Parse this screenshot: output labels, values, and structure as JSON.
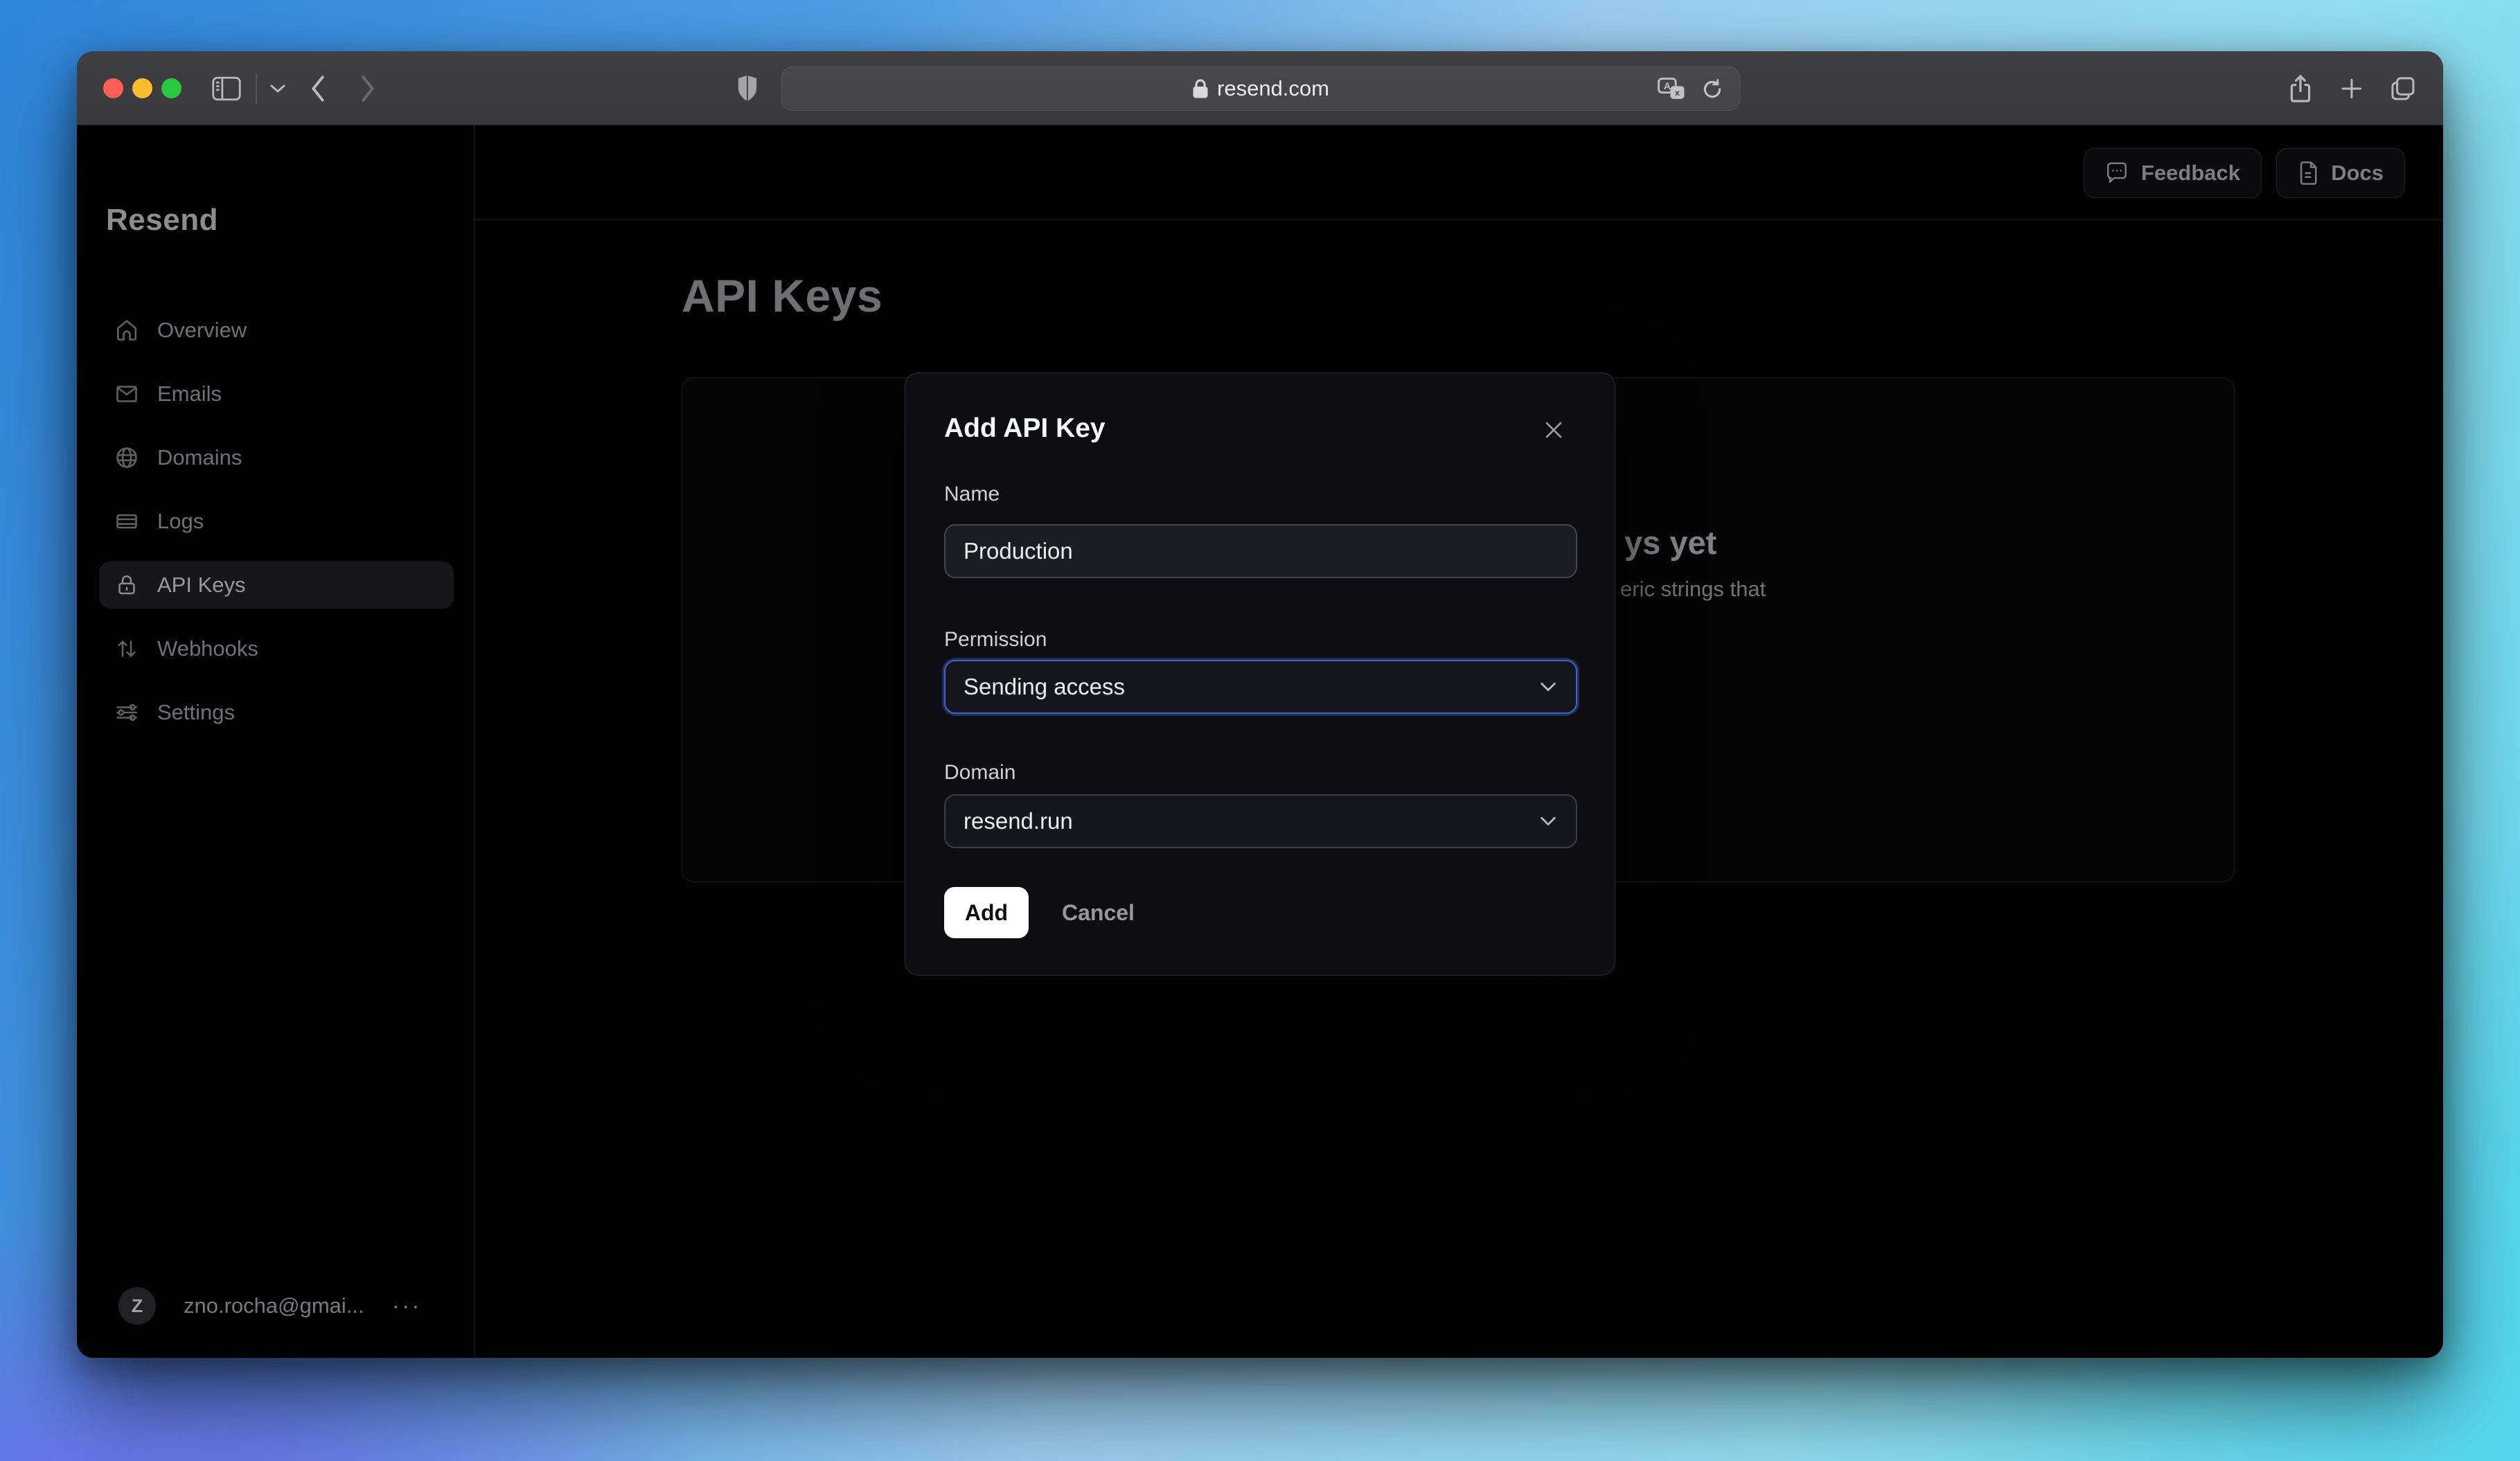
{
  "browser": {
    "url": "resend.com",
    "icons": {
      "window_controls": [
        "close",
        "minimize",
        "zoom"
      ],
      "left": [
        "sidebar-toggle",
        "chevron-down",
        "back",
        "forward"
      ],
      "security": "shield",
      "urlbar": [
        "lock",
        "translate",
        "reload"
      ],
      "right": [
        "share",
        "new-tab",
        "tab-overview"
      ]
    }
  },
  "sidebar": {
    "logo": "Resend",
    "items": [
      {
        "label": "Overview",
        "icon": "home-icon",
        "active": false
      },
      {
        "label": "Emails",
        "icon": "mail-icon",
        "active": false
      },
      {
        "label": "Domains",
        "icon": "globe-icon",
        "active": false
      },
      {
        "label": "Logs",
        "icon": "logs-icon",
        "active": false
      },
      {
        "label": "API Keys",
        "icon": "lock-icon",
        "active": true
      },
      {
        "label": "Webhooks",
        "icon": "arrows-up-down-icon",
        "active": false
      },
      {
        "label": "Settings",
        "icon": "sliders-icon",
        "active": false
      }
    ],
    "user": {
      "initial": "Z",
      "email": "zno.rocha@gmai...",
      "menu": "···"
    }
  },
  "header": {
    "feedback_label": "Feedback",
    "docs_label": "Docs"
  },
  "main": {
    "title": "API Keys",
    "empty_state": {
      "heading_fragment": "ys yet",
      "body_fragment": "eric strings that"
    }
  },
  "modal": {
    "title": "Add API Key",
    "fields": [
      {
        "label": "Name",
        "type": "input",
        "value": "Production"
      },
      {
        "label": "Permission",
        "type": "select",
        "value": "Sending access",
        "focused": true
      },
      {
        "label": "Domain",
        "type": "select",
        "value": "resend.run",
        "focused": false
      }
    ],
    "add_label": "Add",
    "cancel_label": "Cancel"
  },
  "colors": {
    "accent_focus": "#4263cf",
    "traffic_red": "#ff5f57",
    "traffic_yellow": "#febc2e",
    "traffic_green": "#28c840",
    "modal_bg": "#0e0e12",
    "app_bg": "#020203"
  }
}
